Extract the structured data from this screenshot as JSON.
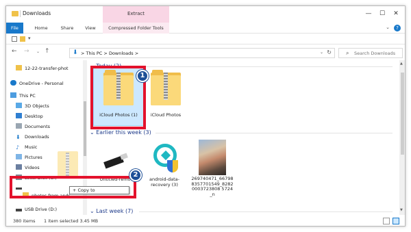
{
  "window": {
    "title": "Downloads",
    "context_tab": "Extract"
  },
  "ribbon": {
    "tabs": [
      "File",
      "Home",
      "Share",
      "View",
      "Compressed Folder Tools"
    ],
    "help": "?"
  },
  "address": {
    "path": [
      "This PC",
      "Downloads"
    ],
    "separator": ">",
    "search_placeholder": "Search Downloads"
  },
  "nav": {
    "items": [
      "12-22-transfer-phot",
      "OneDrive - Personal",
      "This PC",
      "3D Objects",
      "Desktop",
      "Documents",
      "Downloads",
      "Music",
      "Pictures",
      "Videos",
      "Local Disk (C:)",
      "photos from andr",
      "USB Drive (D:)"
    ]
  },
  "groups": {
    "today": "Today (2)",
    "earlier": "Earlier this week (3)",
    "last_week": "Last week (7)"
  },
  "files": {
    "today": [
      "iCloud Photos (1)",
      "iCloud Photos"
    ],
    "earlier": [
      "Untitled-remov",
      "android-data-recovery (3)",
      "269740471_667988357701549_8282000372380857240_n"
    ]
  },
  "earlier_file3_lines": [
    "269740471_66798",
    "8357701549_8282",
    "0003723808 5724",
    "_n"
  ],
  "drag": {
    "copy_label": "+ Copy to"
  },
  "markers": {
    "one": "1",
    "two": "2"
  },
  "status": {
    "count": "380 items",
    "selected": "1 item selected  3.45 MB"
  },
  "colors": {
    "accent": "#1979ca",
    "extract_tab": "#f9d6e5",
    "annotation_red": "#e3122c",
    "marker_blue": "#1d4f97",
    "folder": "#f0bd4a"
  }
}
